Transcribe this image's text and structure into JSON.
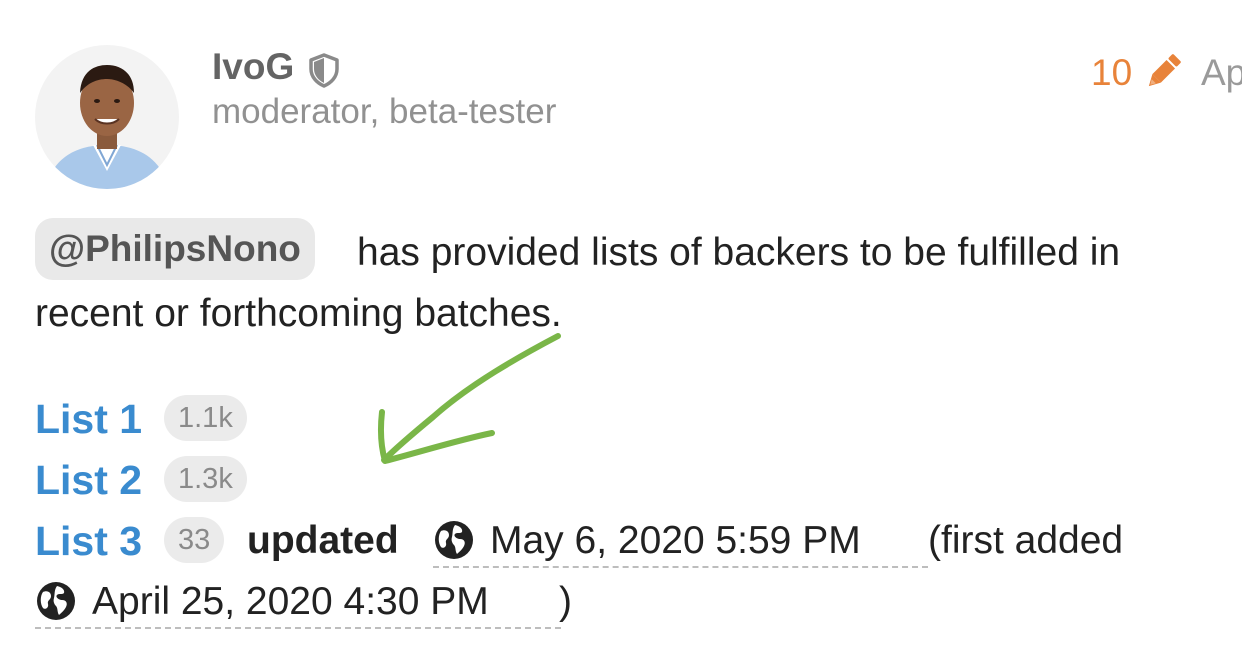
{
  "post": {
    "author": {
      "username": "IvoG",
      "title": "moderator, beta-tester",
      "avatar_icon": "avatar-photo",
      "badge_icon": "shield-icon"
    },
    "edit_count": "10",
    "edit_icon": "pencil-icon",
    "date_fragment": "Ap",
    "body": {
      "mention": "@PhilipsNono",
      "line1_rest": "has provided lists of backers to be fulfilled in",
      "line2": "recent or forthcoming batches."
    },
    "lists": [
      {
        "label": "List 1",
        "clicks": "1.1k"
      },
      {
        "label": "List 2",
        "clicks": "1.3k"
      },
      {
        "label": "List 3",
        "clicks": "33"
      }
    ],
    "updated_label": "updated",
    "updated_date": "May 6, 2020 5:59 PM",
    "first_added_prefix": "(first added",
    "first_added_date": "April 25, 2020 4:30 PM",
    "first_added_suffix": ")"
  },
  "colors": {
    "link": "#3a8bcf",
    "edit": "#e8833a",
    "annotation_arrow": "#7ab648"
  }
}
